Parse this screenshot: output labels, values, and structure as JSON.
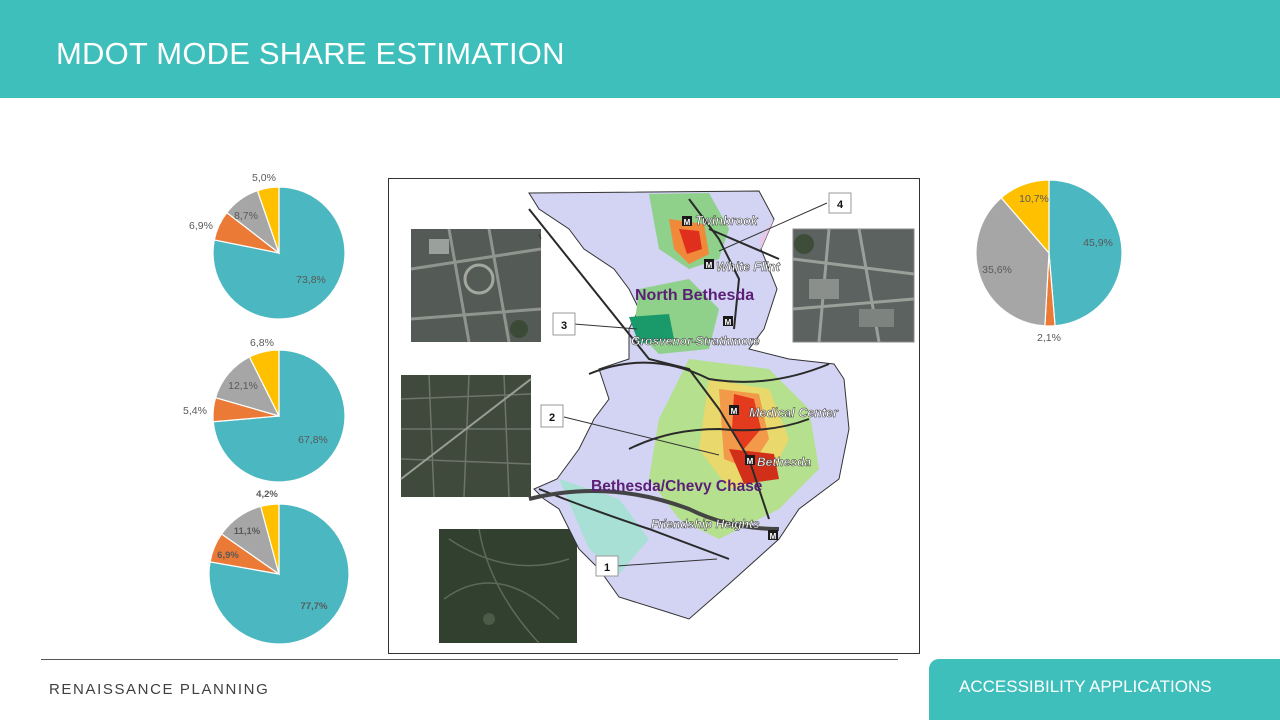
{
  "slide": {
    "title": "MDOT MODE SHARE ESTIMATION",
    "brand": "RENAISSANCE PLANNING",
    "section_tab": "ACCESSIBILITY APPLICATIONS"
  },
  "colors": {
    "teal": "#4bb7c0",
    "orange": "#ea7a35",
    "gray": "#a6a6a6",
    "yellow": "#ffc000",
    "header": "#3fbfbc"
  },
  "chart_data": [
    {
      "type": "pie",
      "slices": [
        {
          "value": 73.8,
          "label": "73,8%",
          "color": "#4bb7c0"
        },
        {
          "value": 6.9,
          "label": "6,9%",
          "color": "#ea7a35"
        },
        {
          "value": 8.7,
          "label": "8,7%",
          "color": "#a6a6a6"
        },
        {
          "value": 5.0,
          "label": "5,0%",
          "color": "#ffc000"
        }
      ]
    },
    {
      "type": "pie",
      "slices": [
        {
          "value": 67.8,
          "label": "67,8%",
          "color": "#4bb7c0"
        },
        {
          "value": 5.4,
          "label": "5,4%",
          "color": "#ea7a35"
        },
        {
          "value": 12.1,
          "label": "12,1%",
          "color": "#a6a6a6"
        },
        {
          "value": 6.8,
          "label": "6,8%",
          "color": "#ffc000"
        }
      ]
    },
    {
      "type": "pie",
      "slices": [
        {
          "value": 77.7,
          "label": "77,7%",
          "color": "#4bb7c0"
        },
        {
          "value": 6.9,
          "label": "6,9%",
          "color": "#ea7a35"
        },
        {
          "value": 11.1,
          "label": "11,1%",
          "color": "#a6a6a6"
        },
        {
          "value": 4.2,
          "label": "4,2%",
          "color": "#ffc000"
        }
      ]
    },
    {
      "type": "pie",
      "slices": [
        {
          "value": 45.9,
          "label": "45,9%",
          "color": "#4bb7c0"
        },
        {
          "value": 2.1,
          "label": "2,1%",
          "color": "#ea7a35"
        },
        {
          "value": 35.6,
          "label": "35,6%",
          "color": "#a6a6a6"
        },
        {
          "value": 10.7,
          "label": "10,7%",
          "color": "#ffc000"
        }
      ]
    }
  ],
  "map": {
    "labels": {
      "twinbrook": "Twinbrook",
      "white_flint": "White Flint",
      "north_bethesda": "North Bethesda",
      "grosvenor": "Grosvenor-Strathmore",
      "medical_center": "Medical Center",
      "bethesda": "Bethesda",
      "bethesda_chevy_chase": "Bethesda/Chevy Chase",
      "friendship_heights": "Friendship Heights"
    },
    "callouts": [
      "1",
      "2",
      "3",
      "4"
    ],
    "metro_marker": "M"
  }
}
